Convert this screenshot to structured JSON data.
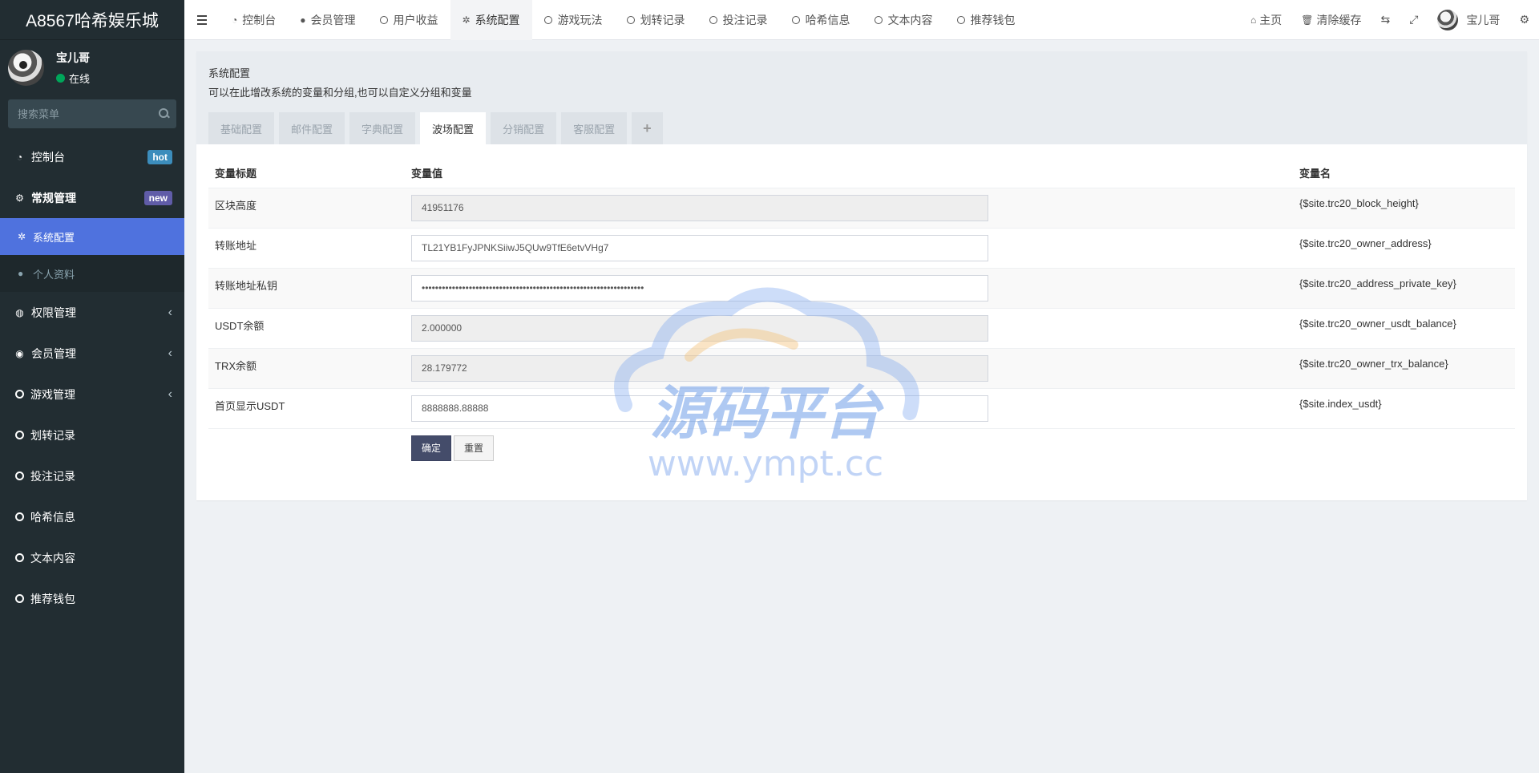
{
  "app": {
    "title": "A8567哈希娱乐城"
  },
  "user": {
    "name": "宝儿哥",
    "status": "在线"
  },
  "search": {
    "placeholder": "搜索菜单"
  },
  "sidebar": {
    "items": [
      {
        "label": "控制台",
        "badge": "hot"
      },
      {
        "label": "常规管理",
        "badge": "new"
      },
      {
        "label": "系统配置"
      },
      {
        "label": "个人资料"
      },
      {
        "label": "权限管理"
      },
      {
        "label": "会员管理"
      },
      {
        "label": "游戏管理"
      },
      {
        "label": "划转记录"
      },
      {
        "label": "投注记录"
      },
      {
        "label": "哈希信息"
      },
      {
        "label": "文本内容"
      },
      {
        "label": "推荐钱包"
      }
    ]
  },
  "navbar": {
    "tabs": [
      {
        "label": "控制台"
      },
      {
        "label": "会员管理"
      },
      {
        "label": "用户收益"
      },
      {
        "label": "系统配置"
      },
      {
        "label": "游戏玩法"
      },
      {
        "label": "划转记录"
      },
      {
        "label": "投注记录"
      },
      {
        "label": "哈希信息"
      },
      {
        "label": "文本内容"
      },
      {
        "label": "推荐钱包"
      }
    ],
    "right": {
      "home": "主页",
      "clear_cache": "清除缓存",
      "user": "宝儿哥"
    }
  },
  "panel": {
    "title": "系统配置",
    "desc": "可以在此增改系统的变量和分组,也可以自定义分组和变量",
    "tabs": [
      {
        "label": "基础配置"
      },
      {
        "label": "邮件配置"
      },
      {
        "label": "字典配置"
      },
      {
        "label": "波场配置"
      },
      {
        "label": "分销配置"
      },
      {
        "label": "客服配置"
      },
      {
        "label": "+"
      }
    ]
  },
  "table": {
    "headers": {
      "title": "变量标题",
      "value": "变量值",
      "name": "变量名"
    },
    "rows": [
      {
        "title": "区块高度",
        "value": "41951176",
        "name": "{$site.trc20_block_height}"
      },
      {
        "title": "转账地址",
        "value": "TL21YB1FyJPNKSiiwJ5QUw9TfE6etvVHg7",
        "name": "{$site.trc20_owner_address}"
      },
      {
        "title": "转账地址私钥",
        "value": "••••••••••••••••••••••••••••••••••••••••••••••••••••••••••••••••••",
        "name": "{$site.trc20_address_private_key}"
      },
      {
        "title": "USDT余额",
        "value": "2.000000",
        "name": "{$site.trc20_owner_usdt_balance}"
      },
      {
        "title": "TRX余额",
        "value": "28.179772",
        "name": "{$site.trc20_owner_trx_balance}"
      },
      {
        "title": "首页显示USDT",
        "value": "8888888.88888",
        "name": "{$site.index_usdt}"
      }
    ]
  },
  "buttons": {
    "submit": "确定",
    "reset": "重置"
  },
  "watermark": {
    "text": "源码平台",
    "url": "www.ympt.cc"
  }
}
